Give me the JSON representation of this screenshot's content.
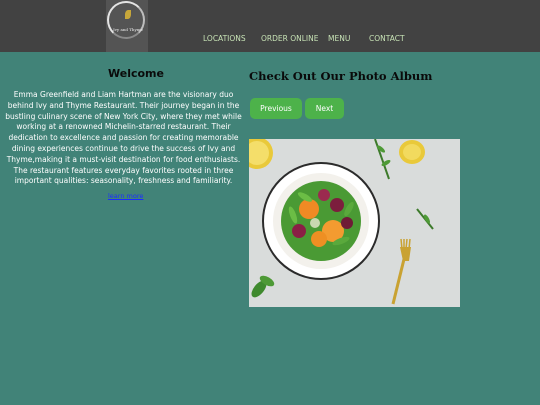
{
  "header": {
    "logo_text": "Ivy and Thyme",
    "nav": [
      "LOCATIONS",
      "ORDER ONLINE",
      "MENU",
      "CONTACT"
    ]
  },
  "welcome": {
    "title": "Welcome",
    "body": "Emma Greenfield and Liam Hartman are the visionary duo behind Ivy and Thyme Restaurant. Their journey began in the bustling culinary scene of New York City, where they met while working at a renowned Michelin-starred restaurant. Their dedication to excellence and passion for creating memorable dining experiences continue to drive the success of Ivy and Thyme,making it a must-visit destination for food enthusiasts. The restaurant features everyday favorites rooted in three important qualities: seasonality, freshness and familiarity.",
    "link": "learn more"
  },
  "album": {
    "title": "Check Out Our Photo Album",
    "prev_label": "Previous",
    "next_label": "Next",
    "photo_icon": "salad-photo"
  },
  "colors": {
    "background": "#418378",
    "topbar": "#424242",
    "nav_text": "#c7e2b5",
    "button": "#4db24a",
    "link": "#1a2cff"
  }
}
